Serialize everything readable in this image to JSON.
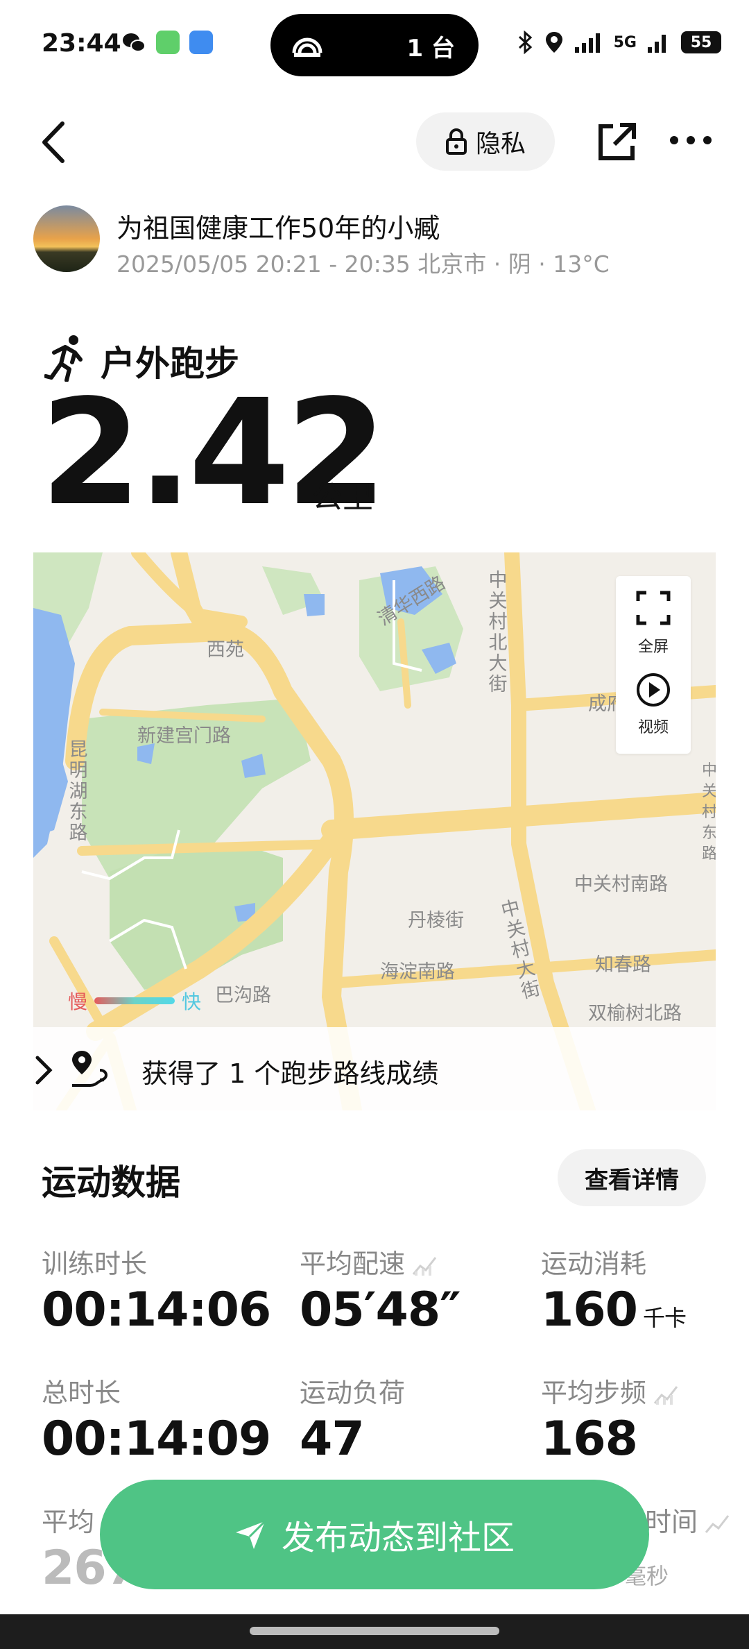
{
  "status_bar": {
    "time": "23:44",
    "cast_count": "1 台",
    "network": "5G",
    "battery": "55"
  },
  "header": {
    "privacy_label": "隐私"
  },
  "user": {
    "name": "为祖国健康工作50年的小臧",
    "meta": "2025/05/05 20:21 - 20:35 北京市 · 阴 · 13°C"
  },
  "activity": {
    "title": "户外跑步",
    "distance": "2.42",
    "unit": "公里"
  },
  "map": {
    "labels": {
      "xiyuan": "西苑",
      "qinghua_xilu": "清华西路",
      "xinjian_gongmen": "新建宫门路",
      "kunming_hu_donglu": "昆明湖东路",
      "zhongguancun_beidajie": "中关村北大街",
      "chengfu": "成府",
      "zhongguancun_nanlu": "中关村南路",
      "danleng": "丹棱街",
      "haidian_nanlu": "海淀南路",
      "zhichun": "知春路",
      "shuangyushu": "双榆树北路",
      "zhongguancun_dajie": "中关村大街",
      "bagou": "巴沟路",
      "right_edge": "中关村东路"
    },
    "controls": {
      "fullscreen": "全屏",
      "video": "视频"
    },
    "legend": {
      "slow": "慢",
      "fast": "快"
    },
    "route_achievement": "获得了 1 个跑步路线成绩"
  },
  "stats": {
    "section_title": "运动数据",
    "detail_button": "查看详情",
    "items": [
      {
        "label": "训练时长",
        "value": "00:14:06",
        "unit": ""
      },
      {
        "label": "平均配速",
        "value": "05′48″",
        "unit": ""
      },
      {
        "label": "运动消耗",
        "value": "160",
        "unit": "千卡"
      },
      {
        "label": "总时长",
        "value": "00:14:09",
        "unit": ""
      },
      {
        "label": "运动负荷",
        "value": "47",
        "unit": ""
      },
      {
        "label": "平均步频",
        "value": "168",
        "unit": ""
      },
      {
        "label": "平均",
        "value": "267",
        "unit": ""
      },
      {
        "label": "时间",
        "value": "",
        "unit": "毫秒"
      }
    ]
  },
  "publish_button": "发布动态到社区",
  "colors": {
    "accent_green": "#4fc485",
    "map_road": "#f7d98c",
    "map_water": "#8fb8ef",
    "map_green": "#bfe0b0"
  }
}
